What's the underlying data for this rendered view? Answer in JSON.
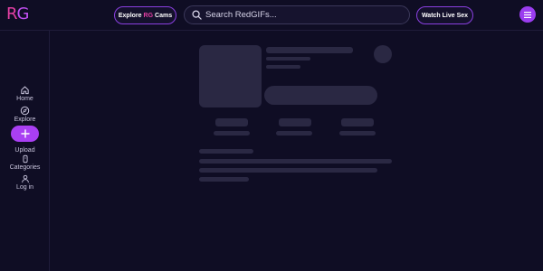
{
  "header": {
    "logo_r": "R",
    "logo_g": "G",
    "explore_cams": {
      "prefix": "Explore",
      "brand": "RG",
      "suffix": "Cams"
    },
    "search_placeholder": "Search RedGIFs...",
    "watch_live": "Watch Live Sex"
  },
  "sidebar": {
    "items": [
      {
        "label": "Home",
        "icon": "home-icon"
      },
      {
        "label": "Explore",
        "icon": "compass-icon"
      },
      {
        "label": "Upload",
        "icon": "plus-icon"
      },
      {
        "label": "Categories",
        "icon": "tag-icon"
      },
      {
        "label": "Log in",
        "icon": "user-icon"
      }
    ]
  },
  "colors": {
    "background": "#0f0d24",
    "accent_purple": "#a93ff3",
    "brand_pink": "#e53fa3",
    "skeleton": "#2a2843"
  }
}
